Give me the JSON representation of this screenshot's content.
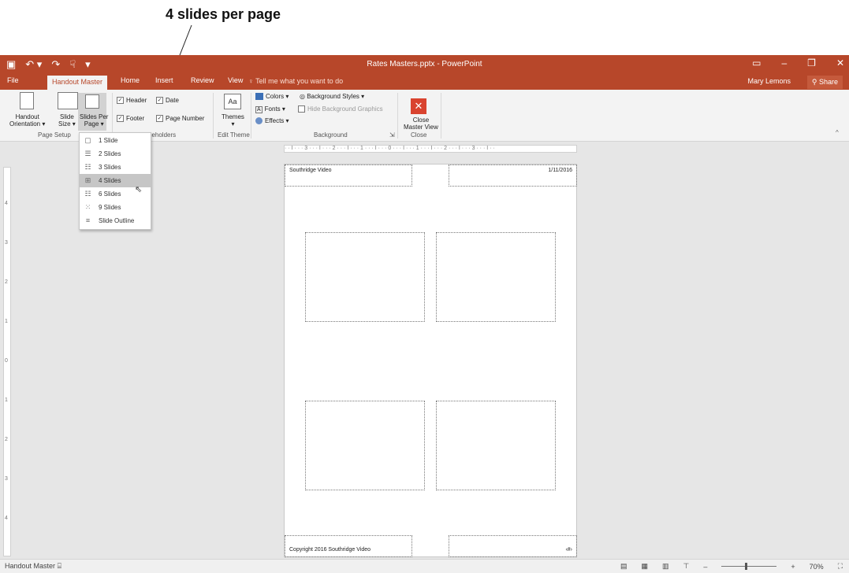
{
  "callout": {
    "text": "4 slides per page"
  },
  "window": {
    "title": "Rates Masters.pptx - PowerPoint",
    "user": "Mary Lemons",
    "share": "Share"
  },
  "tabs": [
    {
      "label": "File"
    },
    {
      "label": "Handout Master",
      "active": true
    },
    {
      "label": "Home"
    },
    {
      "label": "Insert"
    },
    {
      "label": "Review"
    },
    {
      "label": "View"
    }
  ],
  "tell_me": "Tell me what you want to do",
  "ribbon": {
    "handout_orientation": [
      "Handout",
      "Orientation ▾"
    ],
    "slide_size": [
      "Slide",
      "Size ▾"
    ],
    "slides_per_page": [
      "Slides Per",
      "Page ▾"
    ],
    "group_page_setup": "Page Setup",
    "header": "Header",
    "date": "Date",
    "footer": "Footer",
    "page_number": "Page Number",
    "group_placeholders": "aceholders",
    "themes": "Themes",
    "group_edit_theme": "Edit Theme",
    "colors": "Colors ▾",
    "background_styles": "Background Styles ▾",
    "fonts": "Fonts ▾",
    "hide_background_graphics": "Hide Background Graphics",
    "effects": "Effects ▾",
    "group_background": "Background",
    "close_master_view": [
      "Close",
      "Master View"
    ],
    "group_close": "Close"
  },
  "dropdown": {
    "items": [
      {
        "label": "1 Slide",
        "icon": "one-slide-icon"
      },
      {
        "label": "2 Slides",
        "icon": "two-slides-icon"
      },
      {
        "label": "3 Slides",
        "icon": "three-slides-icon"
      },
      {
        "label": "4 Slides",
        "icon": "four-slides-icon",
        "selected": true
      },
      {
        "label": "6 Slides",
        "icon": "six-slides-icon"
      },
      {
        "label": "9 Slides",
        "icon": "nine-slides-icon"
      },
      {
        "label": "Slide Outline",
        "icon": "outline-icon"
      }
    ]
  },
  "ruler": {
    "horizontal": "· · I · · · 3 · · · I · · · 2 · · · I · · · 1 · · · I · · · 0 · · · I · · · 1 · · · I · · · 2 · · · I · · · 3 · · · I · ·",
    "vertical": [
      "4",
      "3",
      "2",
      "1",
      "0",
      "1",
      "2",
      "3",
      "4"
    ]
  },
  "page": {
    "header_text": "Southridge Video",
    "date_text": "1/11/2016",
    "footer_text": "Copyright 2016 Southridge Video",
    "page_number_text": "‹#›"
  },
  "status": {
    "mode": "Handout Master",
    "zoom": "70%"
  },
  "colors": {
    "accent": "#b7472a",
    "ribbon": "#f3f3f3",
    "canvas": "#e6e6e6"
  }
}
